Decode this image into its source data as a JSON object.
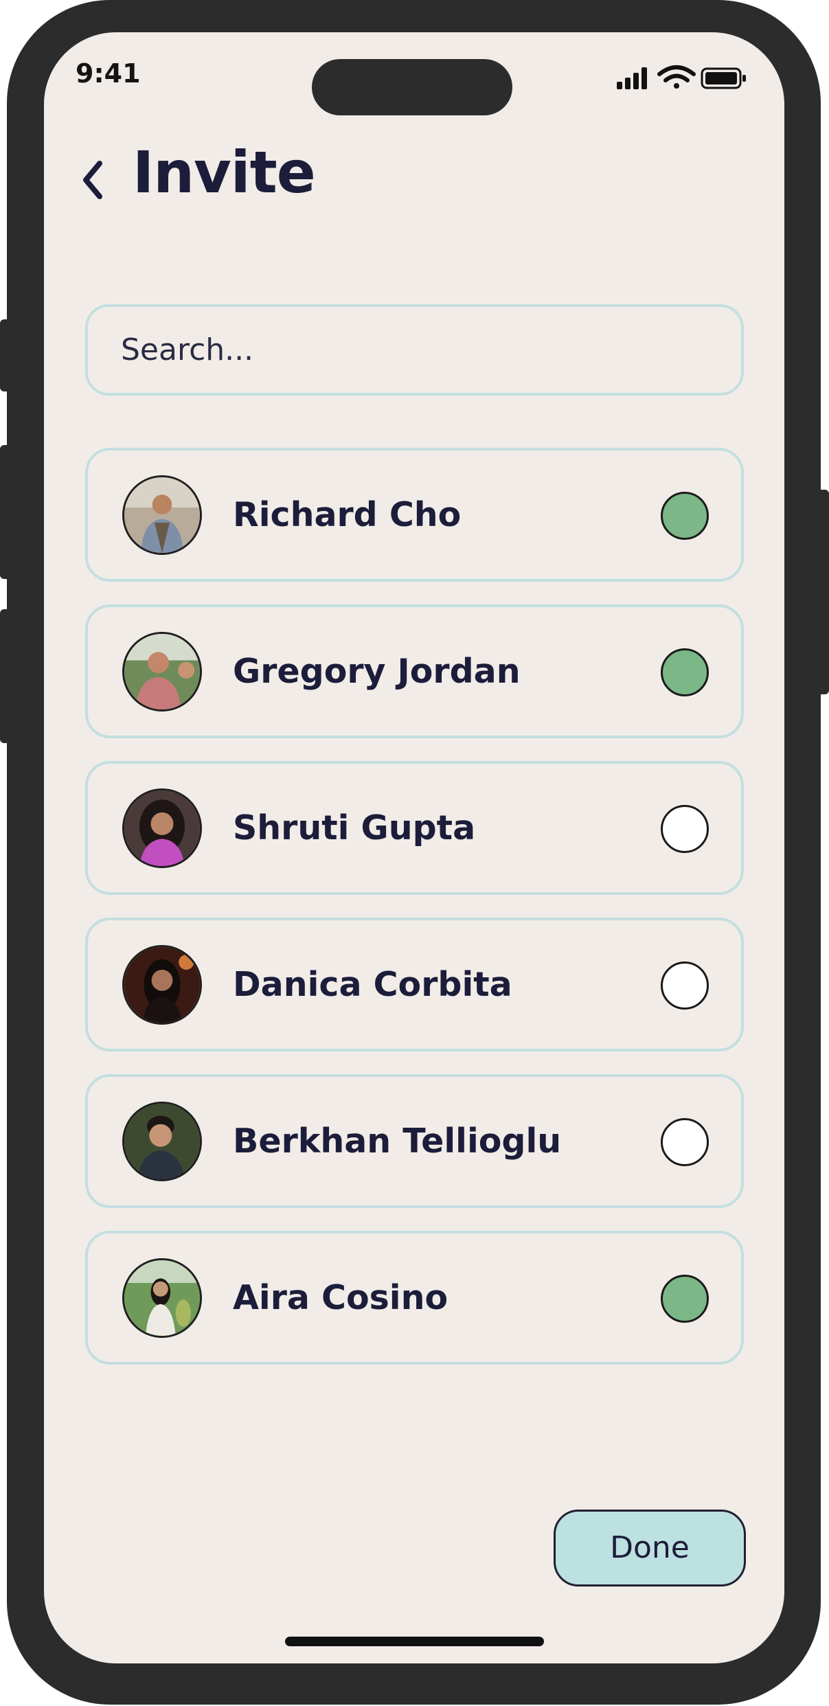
{
  "status_bar": {
    "time": "9:41"
  },
  "header": {
    "title": "Invite"
  },
  "search": {
    "placeholder": "Search..."
  },
  "contacts": [
    {
      "name": "Richard Cho",
      "selected": true
    },
    {
      "name": "Gregory Jordan",
      "selected": true
    },
    {
      "name": "Shruti Gupta",
      "selected": false
    },
    {
      "name": "Danica Corbita",
      "selected": false
    },
    {
      "name": "Berkhan Tellioglu",
      "selected": false
    },
    {
      "name": "Aira Cosino",
      "selected": true
    }
  ],
  "footer": {
    "done_label": "Done"
  },
  "colors": {
    "background": "#f2ece8",
    "text": "#1b1d3a",
    "border": "#c3dfdf",
    "selected": "#7bb787",
    "done_button": "#bde0e0"
  }
}
